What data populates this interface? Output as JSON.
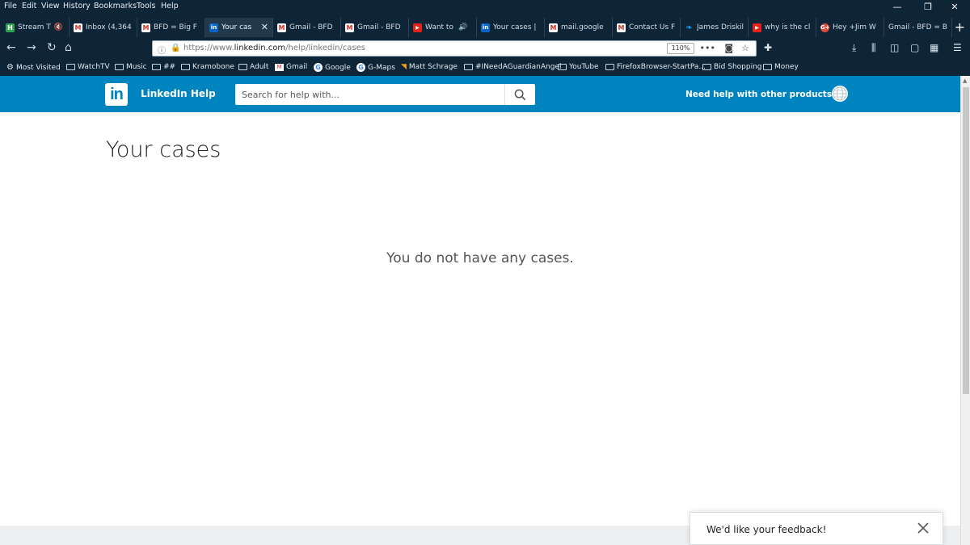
{
  "menu": [
    "File",
    "Edit",
    "View",
    "History",
    "Bookmarks",
    "Tools",
    "Help"
  ],
  "tabs": [
    {
      "title": "Stream T",
      "icon": "h",
      "glyph": "H"
    },
    {
      "title": "Inbox (4,364",
      "icon": "m",
      "glyph": "M"
    },
    {
      "title": "BFD = Big F",
      "icon": "m",
      "glyph": "M"
    },
    {
      "title": "Your cas",
      "icon": "in",
      "glyph": "in",
      "active": true
    },
    {
      "title": "Gmail - BFD",
      "icon": "m",
      "glyph": "M"
    },
    {
      "title": "Gmail - BFD",
      "icon": "m",
      "glyph": "M"
    },
    {
      "title": "Want to",
      "icon": "yt",
      "glyph": "▶"
    },
    {
      "title": "Your cases |",
      "icon": "in",
      "glyph": "in"
    },
    {
      "title": "mail.google",
      "icon": "m",
      "glyph": "M"
    },
    {
      "title": "Contact Us F",
      "icon": "cu",
      "glyph": "M"
    },
    {
      "title": "James Driskil",
      "icon": "tw",
      "glyph": "🐦"
    },
    {
      "title": "why is the cl",
      "icon": "yt",
      "glyph": "▶"
    },
    {
      "title": "Hey +Jim W",
      "icon": "gp",
      "glyph": "G+"
    },
    {
      "title": "Gmail - BFD = B",
      "icon": "none",
      "glyph": ""
    }
  ],
  "url": {
    "prefix": "https://www.",
    "domain": "linkedin.com",
    "path": "/help/linkedin/cases",
    "zoom": "110%"
  },
  "bookmarks": [
    {
      "label": "Most Visited",
      "icon": "gear"
    },
    {
      "label": "WatchTV",
      "icon": "folder"
    },
    {
      "label": "Music",
      "icon": "folder"
    },
    {
      "label": "##",
      "icon": "folder"
    },
    {
      "label": "Kramobone",
      "icon": "folder"
    },
    {
      "label": "Adult",
      "icon": "folder"
    },
    {
      "label": "Gmail",
      "icon": "gmail"
    },
    {
      "label": "Google",
      "icon": "google"
    },
    {
      "label": "G-Maps",
      "icon": "google"
    },
    {
      "label": "Matt Schrage",
      "icon": "rss"
    },
    {
      "label": "#INeedAGuardianAngel",
      "icon": "folder"
    },
    {
      "label": "YouTube",
      "icon": "folder"
    },
    {
      "label": "FirefoxBrowser-StartPa...",
      "icon": "folder"
    },
    {
      "label": "Bid Shopping",
      "icon": "folder"
    },
    {
      "label": "Money",
      "icon": "folder"
    }
  ],
  "header": {
    "logo": "in",
    "title": "LinkedIn Help",
    "search_placeholder": "Search for help with...",
    "help_link": "Need help with other products?"
  },
  "page": {
    "title": "Your cases",
    "empty_message": "You do not have any cases."
  },
  "feedback": {
    "text": "We'd like your feedback!"
  },
  "colors": {
    "chrome": "#0e2538",
    "linkedin_blue": "#0084bf"
  }
}
